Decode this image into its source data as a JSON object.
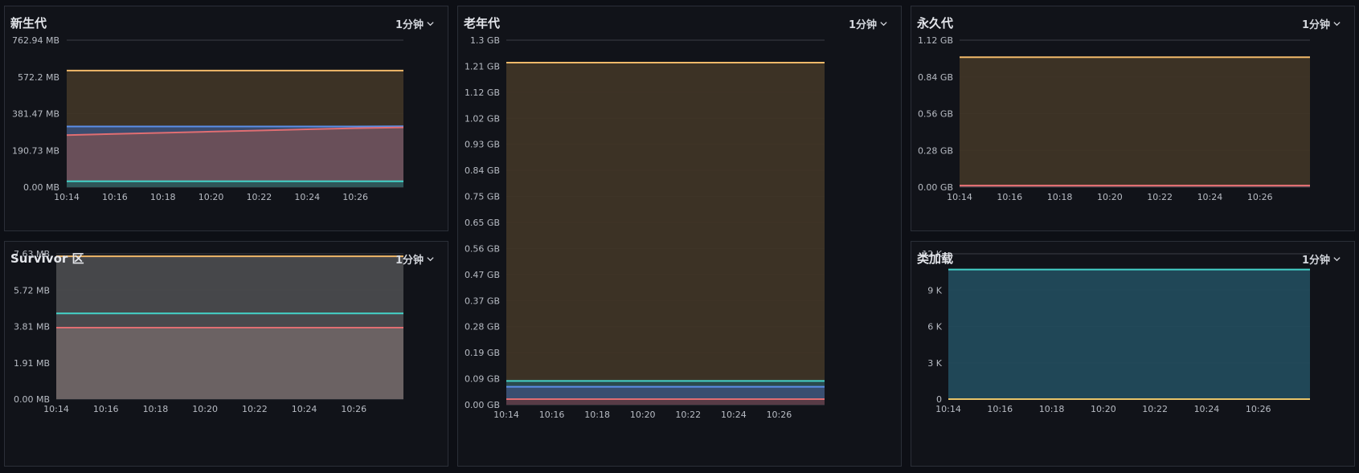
{
  "colors": {
    "orange": "#f2b96a",
    "blue": "#5b8ee8",
    "red": "#e06e72",
    "teal": "#44d3c9",
    "yellow": "#e8c56a"
  },
  "time_label": "1分钟",
  "chart_data": [
    {
      "type": "area",
      "title": "新生代",
      "x": [
        "10:14",
        "10:16",
        "10:18",
        "10:20",
        "10:22",
        "10:24",
        "10:26"
      ],
      "ylim": [
        0,
        762.94
      ],
      "yticks": [
        "762.94 MB",
        "572.2 MB",
        "381.47 MB",
        "190.73 MB",
        "0.00 MB"
      ],
      "series": [
        {
          "color": "#f2b96a",
          "fill": "#3f3426",
          "values": [
            605,
            605,
            605,
            605,
            605,
            605,
            605,
            605
          ]
        },
        {
          "color": "#5b8ee8",
          "fill": "#3a4e72",
          "values": [
            315,
            315,
            315,
            315,
            315,
            315,
            315,
            316
          ]
        },
        {
          "color": "#e06e72",
          "fill": "#6c4f57",
          "values": [
            270,
            276,
            282,
            288,
            294,
            300,
            306,
            310
          ]
        },
        {
          "color": "#44d3c9",
          "fill": "#2b5659",
          "values": [
            30,
            30,
            30,
            30,
            30,
            30,
            30,
            30
          ]
        }
      ]
    },
    {
      "type": "area",
      "title": "老年代",
      "x": [
        "10:14",
        "10:16",
        "10:18",
        "10:20",
        "10:22",
        "10:24",
        "10:26"
      ],
      "ylim": [
        0,
        1.3
      ],
      "yticks": [
        "1.3 GB",
        "1.21 GB",
        "1.12 GB",
        "1.02 GB",
        "0.93 GB",
        "0.84 GB",
        "0.75 GB",
        "0.65 GB",
        "0.56 GB",
        "0.47 GB",
        "0.37 GB",
        "0.28 GB",
        "0.19 GB",
        "0.09 GB",
        "0.00 GB"
      ],
      "series": [
        {
          "color": "#f2b96a",
          "fill": "#3f3426",
          "values": [
            1.22,
            1.22,
            1.22,
            1.22,
            1.22,
            1.22,
            1.22,
            1.22
          ]
        },
        {
          "color": "#44d3c9",
          "fill": "#2a4c4f",
          "values": [
            0.085,
            0.085,
            0.085,
            0.085,
            0.085,
            0.085,
            0.085,
            0.085
          ]
        },
        {
          "color": "#5b8ee8",
          "fill": "#3a4e72",
          "values": [
            0.064,
            0.064,
            0.064,
            0.064,
            0.064,
            0.064,
            0.064,
            0.064
          ]
        },
        {
          "color": "#e06e72",
          "fill": "#5a3a43",
          "values": [
            0.02,
            0.02,
            0.02,
            0.02,
            0.02,
            0.02,
            0.02,
            0.02
          ]
        }
      ]
    },
    {
      "type": "area",
      "title": "永久代",
      "x": [
        "10:14",
        "10:16",
        "10:18",
        "10:20",
        "10:22",
        "10:24",
        "10:26"
      ],
      "ylim": [
        0,
        1.12
      ],
      "yticks": [
        "1.12 GB",
        "0.84 GB",
        "0.56 GB",
        "0.28 GB",
        "0.00 GB"
      ],
      "series": [
        {
          "color": "#f2b96a",
          "fill": "#3f3426",
          "values": [
            0.99,
            0.99,
            0.99,
            0.99,
            0.99,
            0.99,
            0.99,
            0.99
          ]
        },
        {
          "color": "#e06e72",
          "fill": "#6c4f57",
          "values": [
            0.012,
            0.012,
            0.012,
            0.012,
            0.012,
            0.012,
            0.012,
            0.012
          ]
        }
      ]
    },
    {
      "type": "area",
      "title": "Survivor 区",
      "x": [
        "10:14",
        "10:16",
        "10:18",
        "10:20",
        "10:22",
        "10:24",
        "10:26"
      ],
      "ylim": [
        0,
        7.63
      ],
      "yticks": [
        "7.63 MB",
        "5.72 MB",
        "3.81 MB",
        "1.91 MB",
        "0.00 MB"
      ],
      "series": [
        {
          "color": "#f2b96a",
          "fill": "#4a4a4d",
          "values": [
            7.5,
            7.5,
            7.5,
            7.5,
            7.5,
            7.5,
            7.5,
            7.5
          ]
        },
        {
          "color": "#44d3c9",
          "fill": "#4a4a4d",
          "values": [
            4.5,
            4.5,
            4.5,
            4.5,
            4.5,
            4.5,
            4.5,
            4.5
          ]
        },
        {
          "color": "#e06e72",
          "fill": "#6e6464",
          "values": [
            3.75,
            3.75,
            3.75,
            3.75,
            3.75,
            3.75,
            3.75,
            3.75
          ]
        }
      ]
    },
    {
      "type": "area",
      "title": "类加载",
      "x": [
        "10:14",
        "10:16",
        "10:18",
        "10:20",
        "10:22",
        "10:24",
        "10:26"
      ],
      "ylim": [
        0,
        12000
      ],
      "yticks": [
        "12 K",
        "9 K",
        "6 K",
        "3 K",
        "0"
      ],
      "series": [
        {
          "color": "#44d3c9",
          "fill": "#224a5b",
          "values": [
            10700,
            10700,
            10700,
            10700,
            10700,
            10700,
            10700,
            10700
          ]
        },
        {
          "color": "#e8c56a",
          "fill": "#224a5b",
          "values": [
            0,
            0,
            0,
            0,
            0,
            0,
            0,
            0
          ]
        }
      ]
    }
  ]
}
